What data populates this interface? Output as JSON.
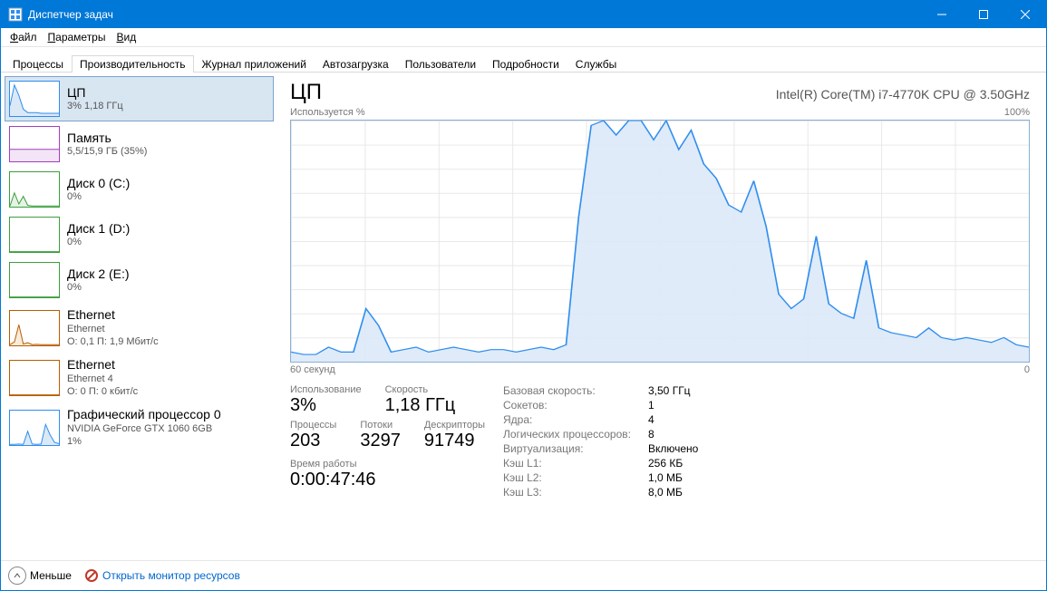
{
  "window": {
    "title": "Диспетчер задач"
  },
  "menu": {
    "file": "Файл",
    "options": "Параметры",
    "view": "Вид"
  },
  "tabs": {
    "processes": "Процессы",
    "performance": "Производительность",
    "app_history": "Журнал приложений",
    "startup": "Автозагрузка",
    "users": "Пользователи",
    "details": "Подробности",
    "services": "Службы"
  },
  "sidebar": [
    {
      "title": "ЦП",
      "sub": "3%  1,18 ГГц",
      "color": "#2e8def",
      "selected": true,
      "kind": "cpu"
    },
    {
      "title": "Память",
      "sub": "5,5/15,9 ГБ (35%)",
      "color": "#a23fbf",
      "kind": "mem"
    },
    {
      "title": "Диск 0 (C:)",
      "sub": "0%",
      "color": "#3c9f3c",
      "kind": "disk"
    },
    {
      "title": "Диск 1 (D:)",
      "sub": "0%",
      "color": "#3c9f3c",
      "kind": "disk_flat"
    },
    {
      "title": "Диск 2 (E:)",
      "sub": "0%",
      "color": "#3c9f3c",
      "kind": "disk_flat"
    },
    {
      "title": "Ethernet",
      "sub": "Ethernet",
      "sub2": "О: 0,1 П: 1,9 Мбит/с",
      "color": "#b85c00",
      "kind": "eth"
    },
    {
      "title": "Ethernet",
      "sub": "Ethernet 4",
      "sub2": "О: 0 П: 0 кбит/с",
      "color": "#b85c00",
      "kind": "eth_flat"
    },
    {
      "title": "Графический процессор 0",
      "sub": "NVIDIA GeForce GTX 1060 6GB",
      "sub2": "1%",
      "color": "#2e8def",
      "kind": "gpu"
    }
  ],
  "main": {
    "title": "ЦП",
    "device": "Intel(R) Core(TM) i7-4770K CPU @ 3.50GHz",
    "axis_top_left": "Используется %",
    "axis_top_right": "100%",
    "axis_bottom_left": "60 секунд",
    "axis_bottom_right": "0",
    "stats_left": {
      "utilization_label": "Использование",
      "utilization": "3%",
      "speed_label": "Скорость",
      "speed": "1,18 ГГц",
      "processes_label": "Процессы",
      "processes": "203",
      "threads_label": "Потоки",
      "threads": "3297",
      "handles_label": "Дескрипторы",
      "handles": "91749",
      "uptime_label": "Время работы",
      "uptime": "0:00:47:46"
    },
    "stats_right": {
      "base_speed_k": "Базовая скорость:",
      "base_speed_v": "3,50 ГГц",
      "sockets_k": "Сокетов:",
      "sockets_v": "1",
      "cores_k": "Ядра:",
      "cores_v": "4",
      "logical_k": "Логических процессоров:",
      "logical_v": "8",
      "virt_k": "Виртуализация:",
      "virt_v": "Включено",
      "l1_k": "Кэш L1:",
      "l1_v": "256 КБ",
      "l2_k": "Кэш L2:",
      "l2_v": "1,0 МБ",
      "l3_k": "Кэш L3:",
      "l3_v": "8,0 МБ"
    }
  },
  "footer": {
    "fewer": "Меньше",
    "resmon": "Открыть монитор ресурсов"
  },
  "chart_data": {
    "type": "area",
    "x": "time_seconds_ago",
    "xlim": [
      60,
      0
    ],
    "ylim": [
      0,
      100
    ],
    "ylabel": "Используется %",
    "series": [
      {
        "name": "CPU %",
        "color": "#2e8def",
        "fill": "#dbe9f7",
        "values": [
          4,
          3,
          3,
          6,
          4,
          4,
          22,
          15,
          4,
          5,
          6,
          4,
          5,
          6,
          5,
          4,
          5,
          5,
          4,
          5,
          6,
          5,
          7,
          60,
          98,
          100,
          94,
          100,
          100,
          92,
          100,
          88,
          96,
          82,
          76,
          65,
          62,
          75,
          56,
          28,
          22,
          26,
          52,
          24,
          20,
          18,
          42,
          14,
          12,
          11,
          10,
          14,
          10,
          9,
          10,
          9,
          8,
          10,
          7,
          6
        ]
      }
    ]
  }
}
